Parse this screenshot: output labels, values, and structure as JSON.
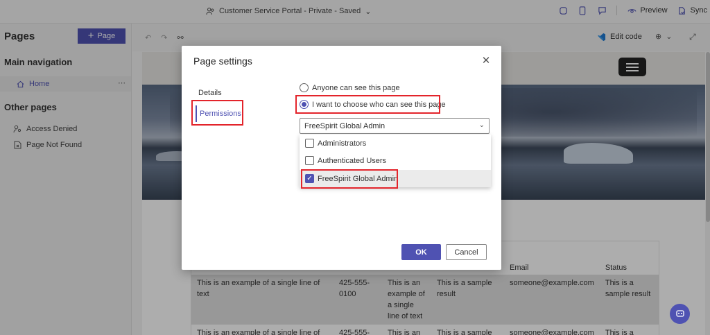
{
  "topbar": {
    "title": "Customer Service Portal - Private - Saved",
    "preview": "Preview",
    "sync": "Sync"
  },
  "leftpane": {
    "pages_title": "Pages",
    "add_page": "Page",
    "main_navigation": "Main navigation",
    "home": "Home",
    "more": "⋯",
    "other_pages": "Other pages",
    "access_denied": "Access Denied",
    "page_not_found": "Page Not Found"
  },
  "canvas": {
    "edit_code": "Edit code"
  },
  "table": {
    "headers": [
      "",
      "",
      "",
      "",
      "Email",
      "Status"
    ],
    "rows": [
      [
        "This is an example of a single line of text",
        "425-555-0100",
        "This is an example of a single line of text",
        "This is a sample result",
        "someone@example.com",
        "This is a sample result"
      ],
      [
        "This is an example of a single line of",
        "425-555-",
        "This is an",
        "This is a sample",
        "someone@example.com",
        "This is a"
      ]
    ]
  },
  "dialog": {
    "title": "Page settings",
    "tabs": {
      "details": "Details",
      "permissions": "Permissions"
    },
    "options": {
      "anyone": "Anyone can see this page",
      "choose": "I want to choose who can see this page"
    },
    "selected_roles": "FreeSpirit Global Admin",
    "roles": [
      {
        "label": "Administrators",
        "checked": false
      },
      {
        "label": "Authenticated Users",
        "checked": false
      },
      {
        "label": "FreeSpirit Global Admin",
        "checked": true
      }
    ],
    "ok": "OK",
    "cancel": "Cancel"
  },
  "colors": {
    "accent": "#4f52b2",
    "highlight": "#e3242b"
  }
}
